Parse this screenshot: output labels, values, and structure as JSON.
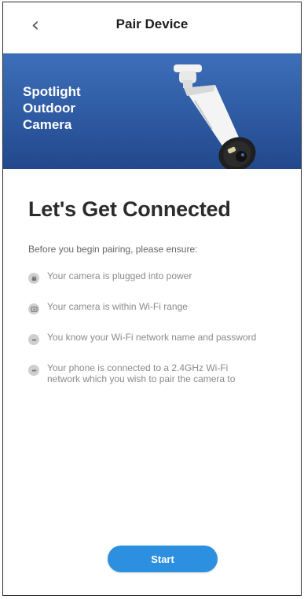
{
  "header": {
    "back_icon": "chevron-left-icon",
    "title": "Pair Device"
  },
  "banner": {
    "line1": "Spotlight",
    "line2": "Outdoor",
    "line3": "Camera",
    "image": "spotlight-outdoor-camera"
  },
  "main": {
    "heading": "Let's Get Connected",
    "subheading": "Before you begin pairing, please ensure:",
    "checklist": [
      {
        "icon": "plug-icon",
        "text": "Your camera is plugged into power"
      },
      {
        "icon": "wifi-range-icon",
        "text": "Your camera is within Wi-Fi range"
      },
      {
        "icon": "key-icon",
        "text": "You know your Wi-Fi network name and password"
      },
      {
        "icon": "phone-wifi-icon",
        "text": "Your phone is connected to a 2.4GHz Wi-Fi network which you wish to pair the camera to"
      }
    ]
  },
  "footer": {
    "start_label": "Start"
  },
  "colors": {
    "banner": "#2e5aa2",
    "button": "#2c8fe0",
    "heading": "#2b2b2b"
  }
}
